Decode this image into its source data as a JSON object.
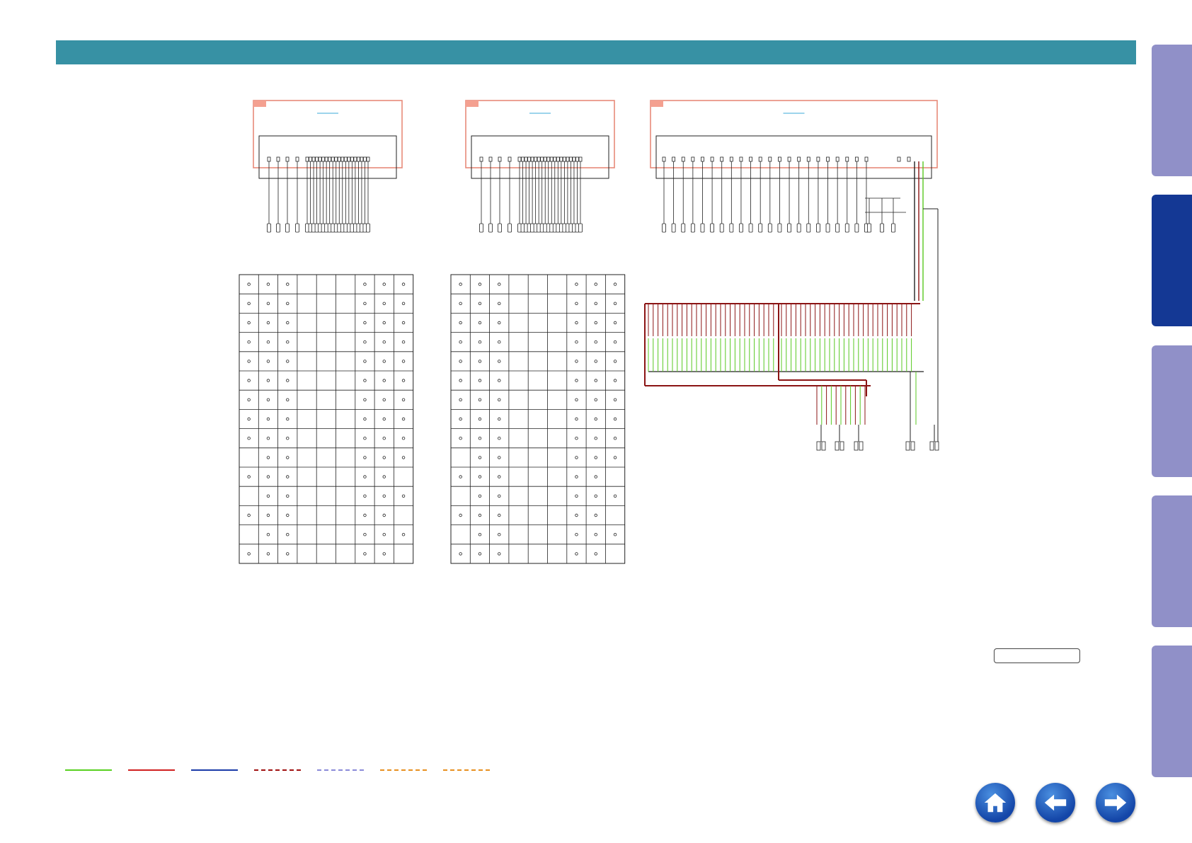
{
  "colors": {
    "header": "#3791a4",
    "side_tab": "#9090c8",
    "side_tab_active": "#143894",
    "module_box": "#e88a7a",
    "wire_red": "#8b1414",
    "wire_green": "#58c820",
    "nav_button": "#1a56c0"
  },
  "side_tabs": [
    {
      "name": "side-tab-1",
      "active": false
    },
    {
      "name": "side-tab-2",
      "active": true
    },
    {
      "name": "side-tab-3",
      "active": false
    },
    {
      "name": "side-tab-4",
      "active": false
    },
    {
      "name": "side-tab-5",
      "active": false
    }
  ],
  "legend": [
    {
      "color": "#58d020",
      "style": "solid"
    },
    {
      "color": "#d02020",
      "style": "solid"
    },
    {
      "color": "#1a3aa8",
      "style": "solid"
    },
    {
      "color": "#a01010",
      "style": "dashed"
    },
    {
      "color": "#8a8ad8",
      "style": "dashed"
    },
    {
      "color": "#e89020",
      "style": "dashed"
    },
    {
      "color": "#e89020",
      "style": "dashed"
    }
  ],
  "nav": {
    "home_icon": "home-icon",
    "back_icon": "arrow-left-icon",
    "forward_icon": "arrow-right-icon"
  }
}
